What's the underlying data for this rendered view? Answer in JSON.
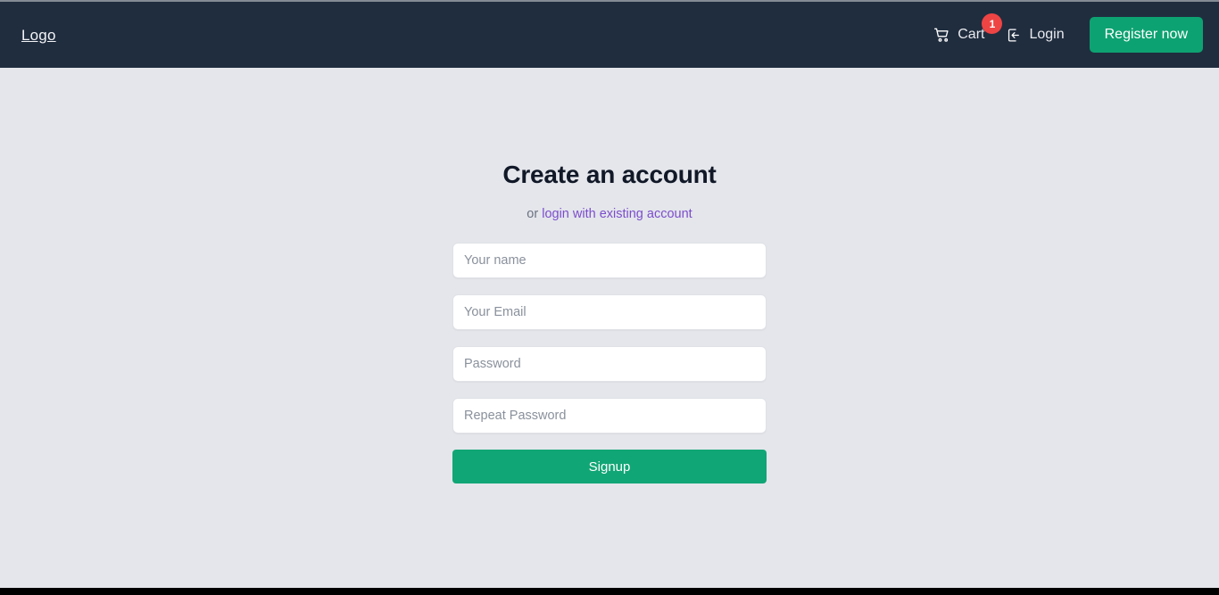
{
  "header": {
    "logo": "Logo",
    "cart": {
      "label": "Cart",
      "icon": "shopping-cart-icon",
      "badge_count": "1",
      "badge_color": "#ef4444"
    },
    "login": {
      "label": "Login",
      "icon": "sign-in-icon"
    },
    "register_button": {
      "label": "Register now",
      "color": "#0da271"
    },
    "background_color": "#202d3f"
  },
  "main": {
    "title": "Create an account",
    "subtitle_prefix": "or ",
    "subtitle_link": "login with existing account",
    "subtitle_link_color": "#7c4dcc",
    "fields": [
      {
        "name": "name",
        "placeholder": "Your name",
        "value": "",
        "type": "text"
      },
      {
        "name": "email",
        "placeholder": "Your Email",
        "value": "",
        "type": "text"
      },
      {
        "name": "password",
        "placeholder": "Password",
        "value": "",
        "type": "text"
      },
      {
        "name": "repeat-password",
        "placeholder": "Repeat Password",
        "value": "",
        "type": "text"
      }
    ],
    "submit_button": {
      "label": "Signup",
      "color": "#11a675"
    },
    "background_color": "#e4e6eb"
  }
}
